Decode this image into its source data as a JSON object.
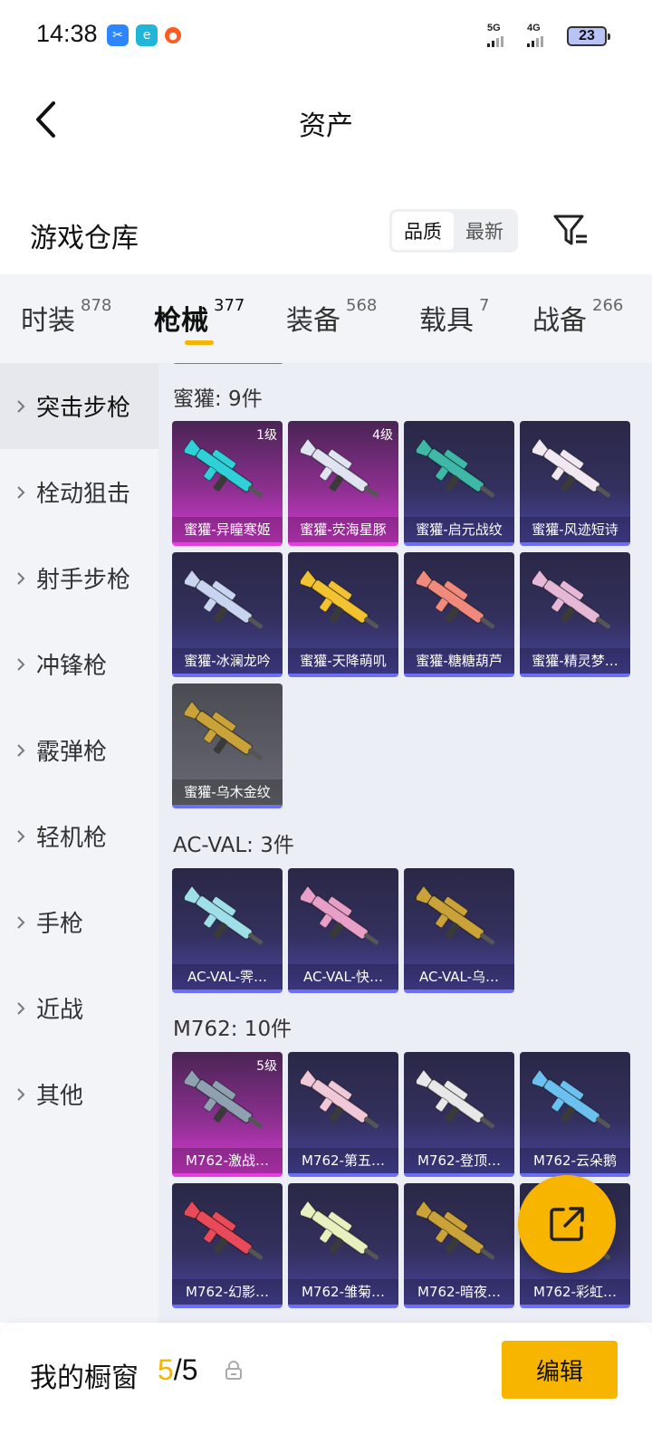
{
  "status_bar": {
    "time": "14:38",
    "net1": "5G",
    "net2": "4G",
    "battery": "23",
    "app_icons": [
      "scissors-app-icon",
      "browser-app-icon",
      "game-app-icon"
    ]
  },
  "header": {
    "title": "资产",
    "back_icon": "chevron-left-icon"
  },
  "warehouse": {
    "title": "游戏仓库",
    "sort_options": [
      "品质",
      "最新"
    ],
    "sort_selected": "品质",
    "filter_icon": "filter-icon"
  },
  "tabs": [
    {
      "label": "时装",
      "count": "878"
    },
    {
      "label": "枪械",
      "count": "377",
      "active": true
    },
    {
      "label": "装备",
      "count": "568"
    },
    {
      "label": "载具",
      "count": "7"
    },
    {
      "label": "战备",
      "count": "266"
    }
  ],
  "sidebar": [
    {
      "label": "突击步枪",
      "active": true
    },
    {
      "label": "栓动狙击"
    },
    {
      "label": "射手步枪"
    },
    {
      "label": "冲锋枪"
    },
    {
      "label": "霰弹枪"
    },
    {
      "label": "轻机枪"
    },
    {
      "label": "手枪"
    },
    {
      "label": "近战"
    },
    {
      "label": "其他"
    }
  ],
  "groups": [
    {
      "title": "蜜獾: 9件",
      "items": [
        {
          "name": "蜜獾-异瞳寒姬",
          "level": "1级",
          "rarity": "pink",
          "color": "#2fd0d8"
        },
        {
          "name": "蜜獾-荧海星豚",
          "level": "4级",
          "rarity": "pink",
          "color": "#dfe4f0"
        },
        {
          "name": "蜜獾-启元战纹",
          "level": "",
          "rarity": "purple",
          "color": "#3fb8a8"
        },
        {
          "name": "蜜獾-风迹短诗",
          "level": "",
          "rarity": "purple",
          "color": "#f2e8f2"
        },
        {
          "name": "蜜獾-冰澜龙吟",
          "level": "",
          "rarity": "purple",
          "color": "#c8d4f0"
        },
        {
          "name": "蜜獾-天降萌叽",
          "level": "",
          "rarity": "purple",
          "color": "#f2c230"
        },
        {
          "name": "蜜獾-糖糖葫芦",
          "level": "",
          "rarity": "purple",
          "color": "#f08a7c"
        },
        {
          "name": "蜜獾-精灵梦…",
          "level": "",
          "rarity": "purple",
          "color": "#e6b8d8"
        },
        {
          "name": "蜜獾-乌木金纹",
          "level": "",
          "rarity": "gray",
          "color": "#c9a23a"
        }
      ]
    },
    {
      "title": "AC-VAL: 3件",
      "items": [
        {
          "name": "AC-VAL-霁…",
          "level": "",
          "rarity": "purple",
          "color": "#9fe0e8"
        },
        {
          "name": "AC-VAL-快…",
          "level": "",
          "rarity": "purple",
          "color": "#e8a0c8"
        },
        {
          "name": "AC-VAL-乌…",
          "level": "",
          "rarity": "purple",
          "color": "#c9a23a"
        }
      ]
    },
    {
      "title": "M762: 10件",
      "items": [
        {
          "name": "M762-激战…",
          "level": "5级",
          "rarity": "pink",
          "color": "#8fa0b0"
        },
        {
          "name": "M762-第五…",
          "level": "",
          "rarity": "purple",
          "color": "#f0c8d8"
        },
        {
          "name": "M762-登顶…",
          "level": "",
          "rarity": "purple",
          "color": "#e8e8e8"
        },
        {
          "name": "M762-云朵鹅",
          "level": "",
          "rarity": "purple",
          "color": "#6cc0f0"
        },
        {
          "name": "M762-幻影…",
          "level": "",
          "rarity": "purple",
          "color": "#e84a5a"
        },
        {
          "name": "M762-雏菊…",
          "level": "",
          "rarity": "purple",
          "color": "#e8f0c0"
        },
        {
          "name": "M762-暗夜…",
          "level": "",
          "rarity": "purple",
          "color": "#c9a23a"
        },
        {
          "name": "M762-彩虹…",
          "level": "",
          "rarity": "purple",
          "color": "#f0f0f0"
        }
      ]
    }
  ],
  "fab": {
    "icon": "share-external-icon",
    "color": "#f7b500"
  },
  "bottom_bar": {
    "label": "我的橱窗",
    "current": "5",
    "total": "5",
    "lock_icon": "lock-icon",
    "edit_label": "编辑"
  },
  "colors": {
    "accent": "#f7b500",
    "pink_rarity": "#e53ee0",
    "purple_rarity": "#6c6ff2"
  }
}
